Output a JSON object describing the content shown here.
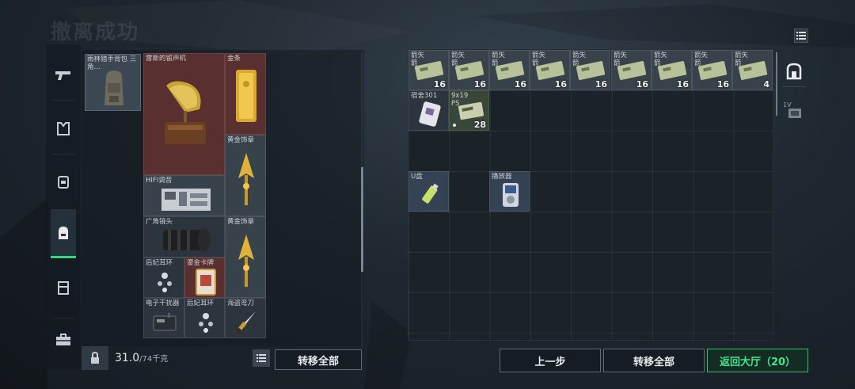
{
  "screen": {
    "title": "撤离成功"
  },
  "sidebar": {
    "tabs": [
      {
        "name": "weapon-tab",
        "icon": "gun-icon"
      },
      {
        "name": "armor-tab",
        "icon": "vest-icon"
      },
      {
        "name": "chest-rig-tab",
        "icon": "chest-rig-icon"
      },
      {
        "name": "backpack-tab",
        "icon": "backpack-icon",
        "active": true
      },
      {
        "name": "container-tab",
        "icon": "pouch-icon"
      },
      {
        "name": "safebox-tab",
        "icon": "briefcase-icon"
      }
    ]
  },
  "backpack": {
    "label": "雨林猎手背包 三角…",
    "items": [
      {
        "label": "雷斯的留声机",
        "icon": "gramophone-icon",
        "rarity": "red"
      },
      {
        "label": "金条",
        "icon": "gold-bar-icon",
        "rarity": "red"
      },
      {
        "label": "黄金饰章",
        "icon": "gold-emblem-icon",
        "rarity": "gray"
      },
      {
        "label": "HIFI调音",
        "icon": "circuit-board-icon",
        "rarity": "gray"
      },
      {
        "label": "广角镜头",
        "icon": "camera-lens-icon",
        "rarity": "dark"
      },
      {
        "label": "黄金饰章",
        "icon": "gold-emblem-icon",
        "rarity": "gray"
      },
      {
        "label": "后妃耳环",
        "icon": "earring-icon",
        "rarity": "dark"
      },
      {
        "label": "鎏金卡牌",
        "icon": "gilded-card-icon",
        "rarity": "red"
      },
      {
        "label": "电子干扰器",
        "icon": "jammer-icon",
        "rarity": "dark"
      },
      {
        "label": "后妃耳环",
        "icon": "earring-icon",
        "rarity": "dark"
      },
      {
        "label": "海盗弯刀",
        "icon": "pirate-knife-icon",
        "rarity": "dark"
      }
    ],
    "weight_current": "31.0",
    "weight_max": "/74千克",
    "transfer_all_label": "转移全部"
  },
  "stash": {
    "ammo_boxes": [
      {
        "label": "箭矢 箭",
        "count": "16"
      },
      {
        "label": "箭矢 箭",
        "count": "16"
      },
      {
        "label": "箭矢 箭",
        "count": "16"
      },
      {
        "label": "箭矢 箭",
        "count": "16"
      },
      {
        "label": "箭矢 箭",
        "count": "16"
      },
      {
        "label": "箭矢 箭",
        "count": "16"
      },
      {
        "label": "箭矢 箭",
        "count": "16"
      },
      {
        "label": "箭矢 箭",
        "count": "16"
      },
      {
        "label": "箭矢 箭",
        "count": "4"
      }
    ],
    "items": [
      {
        "label": "宿舍301",
        "icon": "key-card-icon"
      },
      {
        "label": "9x19 PS",
        "count": "28",
        "icon": "ammo-box-icon"
      },
      {
        "label": "U盘",
        "icon": "usb-drive-icon"
      },
      {
        "label": "播放器",
        "icon": "mp3-player-icon"
      }
    ]
  },
  "right_tabs": {
    "tab1_icon": "safehouse-icon",
    "tab2_label": "1V",
    "tab2_icon": "device-icon"
  },
  "footer": {
    "back_label": "上一步",
    "transfer_all_label": "转移全部",
    "return_label": "返回大厅（20）"
  },
  "colors": {
    "accent_green": "#3fe68c",
    "rarity_red": "#5a2f2f",
    "rarity_gray": "#38424b"
  }
}
